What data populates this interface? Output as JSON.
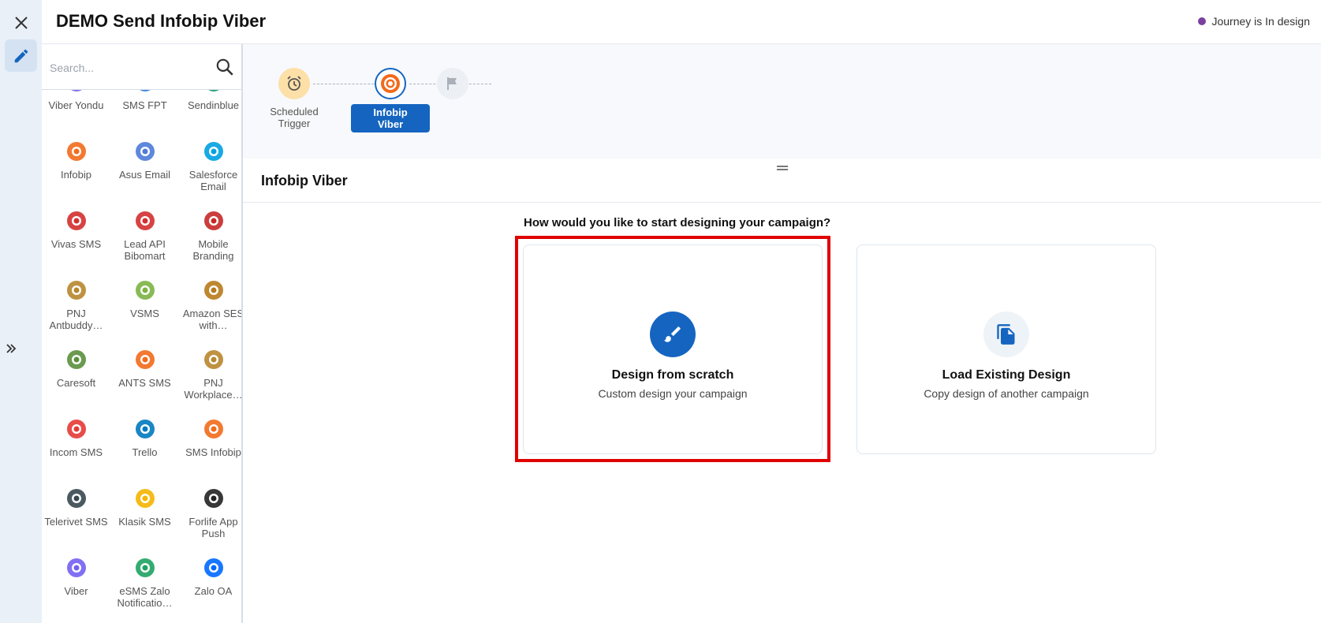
{
  "header": {
    "title": "DEMO Send Infobip Viber",
    "status": "Journey is In design",
    "status_color": "#7b3f9e"
  },
  "search": {
    "placeholder": "Search..."
  },
  "channels": [
    {
      "label": "Viber Yondu",
      "icon": "viber-icon",
      "color": "#7360f2"
    },
    {
      "label": "SMS FPT",
      "icon": "telecom-logo-icon",
      "color": "#2a7fd4"
    },
    {
      "label": "Sendinblue",
      "icon": "sendinblue-icon",
      "color": "#0b996e"
    },
    {
      "label": "Infobip",
      "icon": "infobip-icon",
      "color": "#f26a1b"
    },
    {
      "label": "Asus Email",
      "icon": "asus-icon",
      "color": "#4d7bd8"
    },
    {
      "label": "Salesforce Email",
      "icon": "salesforce-icon",
      "color": "#00a1e0"
    },
    {
      "label": "Vivas SMS",
      "icon": "lotus-icon",
      "color": "#d32f2f"
    },
    {
      "label": "Lead API Bibomart",
      "icon": "bibomart-icon",
      "color": "#d32f2f"
    },
    {
      "label": "Mobile Branding",
      "icon": "vmg-icon",
      "color": "#c62828"
    },
    {
      "label": "PNJ Antbuddy…",
      "icon": "pnj-icon",
      "color": "#b8862e"
    },
    {
      "label": "VSMS",
      "icon": "vsms-icon",
      "color": "#7cb342"
    },
    {
      "label": "Amazon SES with…",
      "icon": "amazon-ses-icon",
      "color": "#b77b1b"
    },
    {
      "label": "Caresoft",
      "icon": "caresoft-icon",
      "color": "#5a8f3c"
    },
    {
      "label": "ANTS SMS",
      "icon": "ants-icon",
      "color": "#f26a1b"
    },
    {
      "label": "PNJ Workplace…",
      "icon": "pnj-icon",
      "color": "#b8862e"
    },
    {
      "label": "Incom SMS",
      "icon": "incom-icon",
      "color": "#e53935"
    },
    {
      "label": "Trello",
      "icon": "trello-icon",
      "color": "#0079bf"
    },
    {
      "label": "SMS Infobip",
      "icon": "infobip-icon",
      "color": "#f26a1b"
    },
    {
      "label": "Telerivet SMS",
      "icon": "telerivet-icon",
      "color": "#37474f"
    },
    {
      "label": "Klasik SMS",
      "icon": "klasik-icon",
      "color": "#f5b400"
    },
    {
      "label": "Forlife App Push",
      "icon": "forlife-icon",
      "color": "#222222"
    },
    {
      "label": "Viber",
      "icon": "viber-icon",
      "color": "#7360f2"
    },
    {
      "label": "eSMS Zalo Notificatio…",
      "icon": "esms-icon",
      "color": "#1ea362"
    },
    {
      "label": "Zalo OA",
      "icon": "zalo-icon",
      "color": "#0068ff"
    }
  ],
  "flow": {
    "nodes": [
      {
        "label": "Scheduled Trigger",
        "icon": "alarm-clock-icon"
      },
      {
        "label": "Infobip Viber",
        "icon": "infobip-icon"
      },
      {
        "label": "",
        "icon": "flag-icon"
      }
    ]
  },
  "section": {
    "title": "Infobip Viber",
    "question": "How would you like to start designing your campaign?"
  },
  "cards": [
    {
      "title": "Design from scratch",
      "subtitle": "Custom design your campaign",
      "icon": "paintbrush-icon"
    },
    {
      "title": "Load Existing Design",
      "subtitle": "Copy design of another campaign",
      "icon": "copy-icon"
    }
  ],
  "colors": {
    "accent": "#1565c0",
    "highlight": "#e00000"
  }
}
